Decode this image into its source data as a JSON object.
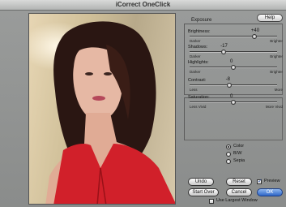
{
  "window": {
    "title": "iCorrect OneClick"
  },
  "panel": {
    "exposure_label": "Exposure",
    "help_label": "Help",
    "sliders": [
      {
        "name": "brightness",
        "label": "Brightness:",
        "value": "+40",
        "min_label": "Darker",
        "max_label": "Brighter",
        "level": 0.74
      },
      {
        "name": "shadows",
        "label": "Shadows:",
        "value": "-17",
        "min_label": "Darker",
        "max_label": "Brighter",
        "level": 0.39
      },
      {
        "name": "highlights",
        "label": "Highlights:",
        "value": "0",
        "min_label": "Darker",
        "max_label": "Brighter",
        "level": 0.5
      },
      {
        "name": "contrast",
        "label": "Contrast:",
        "value": "-8",
        "min_label": "Less",
        "max_label": "More",
        "level": 0.45
      },
      {
        "name": "saturation",
        "label": "Saturation:",
        "value": "0",
        "min_label": "Less Vivid",
        "max_label": "More Vivid",
        "level": 0.5
      }
    ],
    "color_modes": [
      {
        "label": "Color",
        "selected": true
      },
      {
        "label": "B/W",
        "selected": false
      },
      {
        "label": "Sepia",
        "selected": false
      }
    ]
  },
  "buttons": {
    "undo": "Undo",
    "reset": "Reset",
    "start_over": "Start Over",
    "cancel": "Cancel",
    "ok": "OK"
  },
  "checkboxes": {
    "preview": {
      "label": "Preview",
      "checked": true
    },
    "largest_window": {
      "label": "Use Largest Window",
      "checked": false
    }
  },
  "colors": {
    "accent": "#2e66c8",
    "dress": "#d1202a",
    "hair": "#2a1612",
    "skin": "#e6b8a4"
  }
}
